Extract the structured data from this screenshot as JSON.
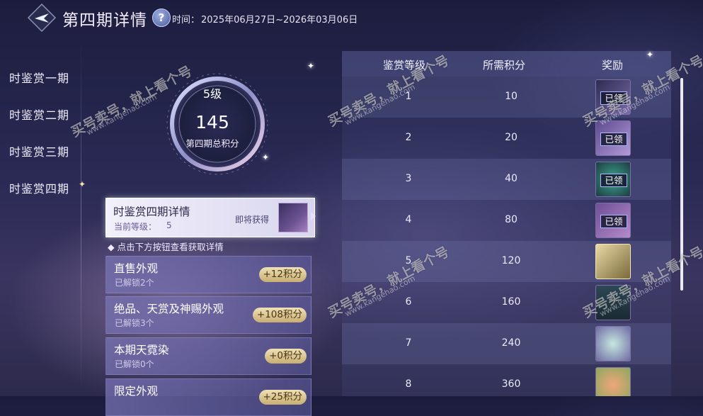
{
  "header": {
    "title": "第四期详情",
    "help_icon": "?",
    "time_label": "时间：",
    "time_value": "2025年06月27日~2026年03月06日"
  },
  "nav": {
    "items": [
      "时鉴赏一期",
      "时鉴赏二期",
      "时鉴赏三期",
      "时鉴赏四期"
    ],
    "active_index": 3
  },
  "level_ring": {
    "level": "5级",
    "score": "145",
    "score_label": "第四期总积分"
  },
  "detail_card": {
    "title": "时鉴赏四期详情",
    "level_label": "当前等级：",
    "level_value": "5",
    "soon_label": "即将获得"
  },
  "hint": "点击下方按钮查看获取详情",
  "categories": [
    {
      "name": "直售外观",
      "unlocked": "已解锁2个",
      "points": "+12积分"
    },
    {
      "name": "绝品、天赏及神赐外观",
      "unlocked": "已解锁3个",
      "points": "+108积分"
    },
    {
      "name": "本期天霓染",
      "unlocked": "已解锁0个",
      "points": "+0积分"
    },
    {
      "name": "限定外观",
      "unlocked": "",
      "points": "+25积分"
    }
  ],
  "table": {
    "headers": [
      "鉴赏等级",
      "所需积分",
      "奖励"
    ],
    "rows": [
      {
        "level": "1",
        "points": "10",
        "claimed": "已领"
      },
      {
        "level": "2",
        "points": "20",
        "claimed": "已领"
      },
      {
        "level": "3",
        "points": "40",
        "claimed": "已领"
      },
      {
        "level": "4",
        "points": "80",
        "claimed": "已领"
      },
      {
        "level": "5",
        "points": "120",
        "claimed": ""
      },
      {
        "level": "6",
        "points": "160",
        "claimed": ""
      },
      {
        "level": "7",
        "points": "240",
        "claimed": ""
      },
      {
        "level": "8",
        "points": "360",
        "claimed": ""
      }
    ]
  },
  "watermark": {
    "text": "买号卖号，就上看个号",
    "site": "www.kangehao.com",
    "badge": "看个号"
  },
  "colors": {
    "accent_gold": "#c7ad72",
    "bg_dark": "#1c1d3e",
    "claimed_border": "#a9b6ff"
  }
}
